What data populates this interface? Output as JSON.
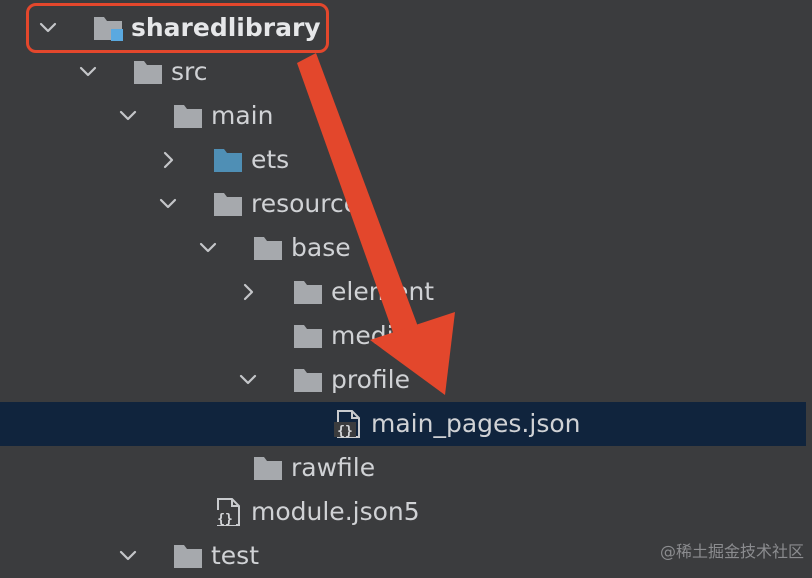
{
  "tree": {
    "rows": [
      {
        "label": "sharedlibrary",
        "indent": 0,
        "expander": "expanded",
        "icon": "module-folder-icon",
        "bold": true
      },
      {
        "label": "src",
        "indent": 1,
        "expander": "expanded",
        "icon": "folder-icon"
      },
      {
        "label": "main",
        "indent": 2,
        "expander": "expanded",
        "icon": "folder-icon"
      },
      {
        "label": "ets",
        "indent": 3,
        "expander": "collapsed",
        "icon": "source-folder-icon"
      },
      {
        "label": "resources",
        "indent": 3,
        "expander": "expanded",
        "icon": "folder-icon"
      },
      {
        "label": "base",
        "indent": 4,
        "expander": "expanded",
        "icon": "folder-icon"
      },
      {
        "label": "element",
        "indent": 5,
        "expander": "collapsed",
        "icon": "folder-icon"
      },
      {
        "label": "media",
        "indent": 5,
        "expander": "none",
        "icon": "folder-icon"
      },
      {
        "label": "profile",
        "indent": 5,
        "expander": "expanded",
        "icon": "folder-icon"
      },
      {
        "label": "main_pages.json",
        "indent": 6,
        "expander": "none",
        "icon": "json-file-icon",
        "selected": true
      },
      {
        "label": "rawfile",
        "indent": 4,
        "expander": "none",
        "icon": "folder-icon"
      },
      {
        "label": "module.json5",
        "indent": 3,
        "expander": "none",
        "icon": "json-file-icon"
      },
      {
        "label": "test",
        "indent": 2,
        "expander": "expanded",
        "icon": "folder-icon"
      }
    ]
  },
  "colors": {
    "background": "#3b3c3e",
    "selection": "#10243d",
    "folder": "#a6a9ad",
    "source_folder": "#4f8fb5",
    "annotation": "#e3472c"
  },
  "watermark": "@稀土掘金技术社区"
}
